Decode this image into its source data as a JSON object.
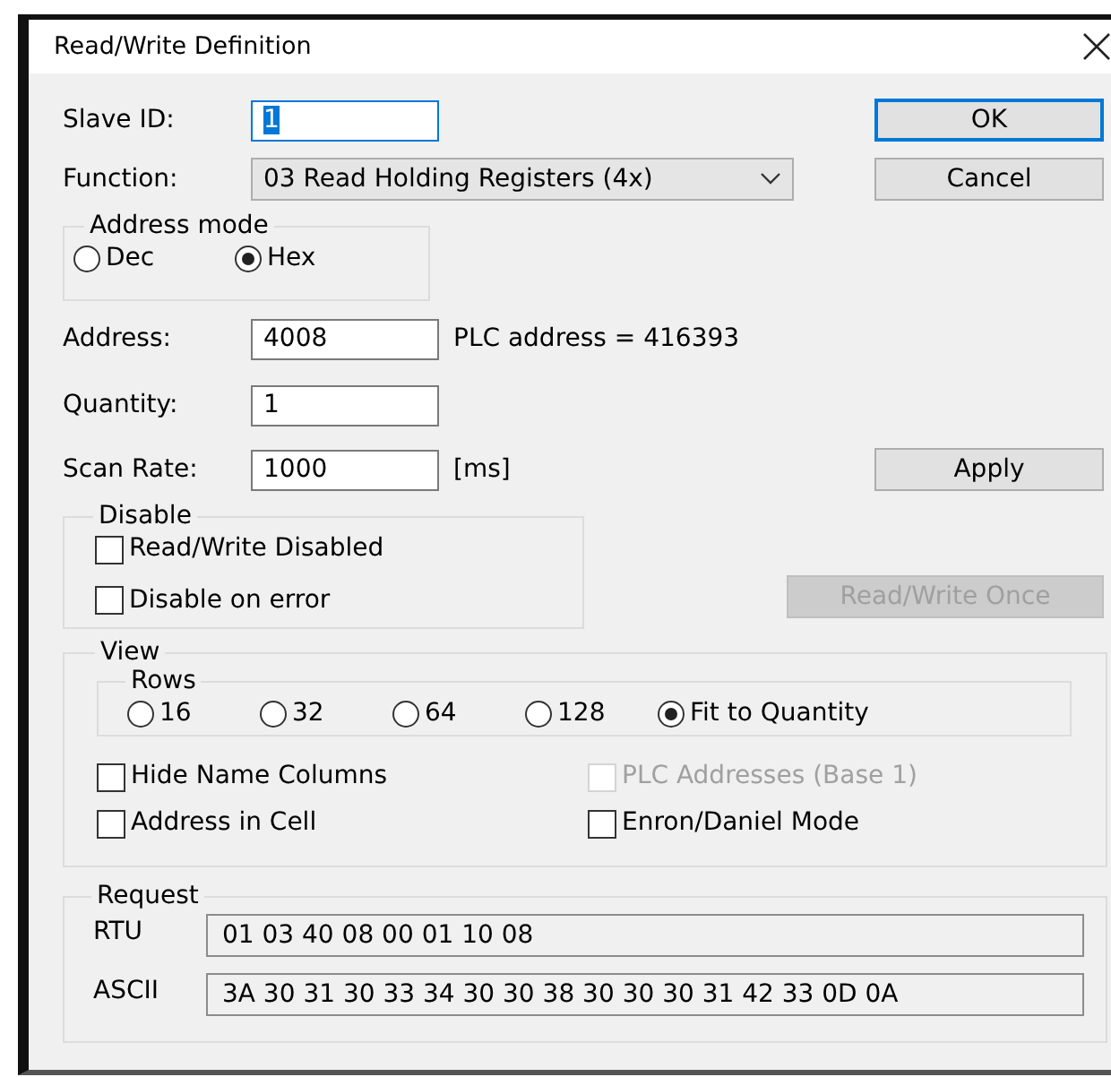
{
  "window": {
    "title": "Read/Write Definition"
  },
  "slave_id": {
    "label": "Slave ID:",
    "value": "1",
    "text_selected": true
  },
  "function": {
    "label": "Function:",
    "value": "03 Read Holding Registers (4x)"
  },
  "address_mode": {
    "title": "Address mode",
    "options": [
      {
        "label": "Dec",
        "selected": false
      },
      {
        "label": "Hex",
        "selected": true
      }
    ]
  },
  "address": {
    "label": "Address:",
    "value": "4008",
    "note": "PLC address = 416393"
  },
  "quantity": {
    "label": "Quantity:",
    "value": "1"
  },
  "scan_rate": {
    "label": "Scan Rate:",
    "value": "1000",
    "unit": "[ms]"
  },
  "disable": {
    "title": "Disable",
    "options": [
      {
        "label": "Read/Write Disabled",
        "checked": false
      },
      {
        "label": "Disable on error",
        "checked": false
      }
    ]
  },
  "buttons": [
    {
      "label": "OK",
      "default": true,
      "disabled": false
    },
    {
      "label": "Cancel",
      "default": false,
      "disabled": false
    },
    {
      "label": "Apply",
      "default": false,
      "disabled": false
    },
    {
      "label": "Read/Write Once",
      "default": false,
      "disabled": true
    }
  ],
  "view": {
    "title": "View",
    "rows": {
      "title": "Rows",
      "options": [
        {
          "label": "16",
          "selected": false
        },
        {
          "label": "32",
          "selected": false
        },
        {
          "label": "64",
          "selected": false
        },
        {
          "label": "128",
          "selected": false
        },
        {
          "label": "Fit to Quantity",
          "selected": true
        }
      ]
    },
    "options": [
      {
        "label": "Hide Name Columns",
        "checked": false,
        "disabled": false
      },
      {
        "label": "PLC Addresses (Base 1)",
        "checked": false,
        "disabled": true
      },
      {
        "label": "Address in Cell",
        "checked": false,
        "disabled": false
      },
      {
        "label": "Enron/Daniel Mode",
        "checked": false,
        "disabled": false
      }
    ]
  },
  "request": {
    "title": "Request",
    "lines": [
      {
        "label": "RTU",
        "value": "01 03 40 08 00 01 10 08"
      },
      {
        "label": "ASCII",
        "value": "3A 30 31 30 33 34 30 30 38 30 30 30 31 42 33 0D 0A"
      }
    ]
  }
}
